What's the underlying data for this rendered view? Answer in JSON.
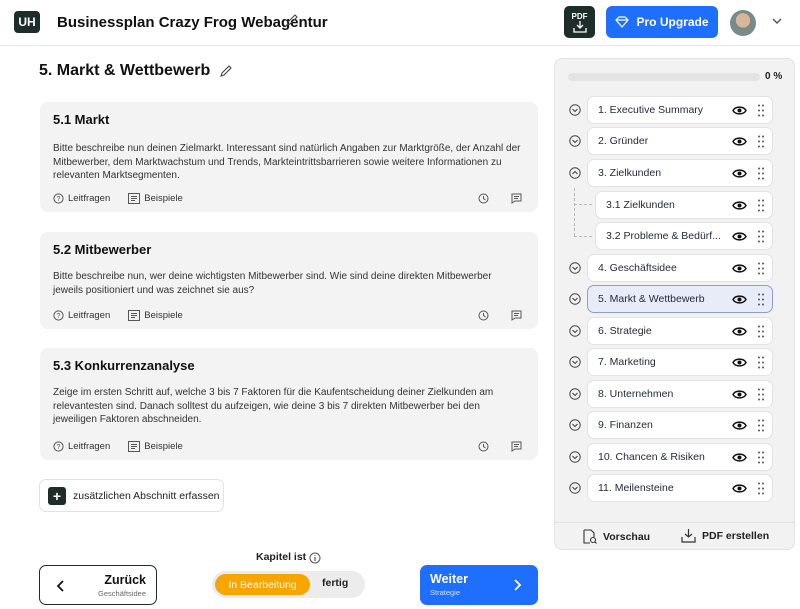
{
  "header": {
    "logo_text": "UH",
    "doc_title": "Businessplan Crazy Frog Webagentur",
    "pdf_badge": "PDF",
    "pro_upgrade": "Pro Upgrade",
    "accent": "#1f6fff"
  },
  "main": {
    "title": "5. Markt & Wettbewerb",
    "cards": [
      {
        "title": "5.1 Markt",
        "text": "Bitte beschreibe nun deinen Zielmarkt. Interessant sind natürlich Angaben zur Marktgröße, der Anzahl der Mitbewerber, dem Marktwachstum und Trends, Markteintrittsbarrieren sowie weitere Informationen zu relevanten Marktsegmenten.",
        "hint": "Leitfragen",
        "examples": "Beispiele"
      },
      {
        "title": "5.2 Mitbewerber",
        "text": "Bitte beschreibe nun, wer deine wichtigsten Mitbewerber sind. Wie sind deine direkten Mitbewerber jeweils positioniert und was zeichnet sie aus?",
        "hint": "Leitfragen",
        "examples": "Beispiele"
      },
      {
        "title": "5.3 Konkurrenzanalyse",
        "text": "Zeige im ersten Schritt auf, welche 3 bis 7 Faktoren für die Kaufentscheidung deiner Zielkunden am relevantesten sind. Danach solltest du aufzeigen, wie deine 3 bis 7 direkten Mitbewerber bei den jeweiligen Faktoren abschneiden.",
        "hint": "Leitfragen",
        "examples": "Beispiele"
      }
    ],
    "add_section": "zusätzlichen Abschnitt erfassen"
  },
  "footer_nav": {
    "back_label": "Zurück",
    "back_sub": "Geschäftsidee",
    "status_label": "Kapitel ist",
    "status_in_progress": "In Bearbeitung",
    "status_done": "fertig",
    "next_label": "Weiter",
    "next_sub": "Strategie",
    "status_color": "#f7a600"
  },
  "sidebar": {
    "progress_text": "0 %",
    "progress_value": 0,
    "items": [
      {
        "label": "1. Executive Summary"
      },
      {
        "label": "2. Gründer"
      },
      {
        "label": "3. Zielkunden"
      },
      {
        "label": "3.1 Zielkunden"
      },
      {
        "label": "3.2 Probleme & Bedürf..."
      },
      {
        "label": "4. Geschäftsidee"
      },
      {
        "label": "5. Markt & Wettbewerb"
      },
      {
        "label": "6. Strategie"
      },
      {
        "label": "7. Marketing"
      },
      {
        "label": "8. Unternehmen"
      },
      {
        "label": "9. Finanzen"
      },
      {
        "label": "10. Chancen & Risiken"
      },
      {
        "label": "11. Meilensteine"
      }
    ],
    "preview": "Vorschau",
    "create_pdf": "PDF erstellen"
  }
}
